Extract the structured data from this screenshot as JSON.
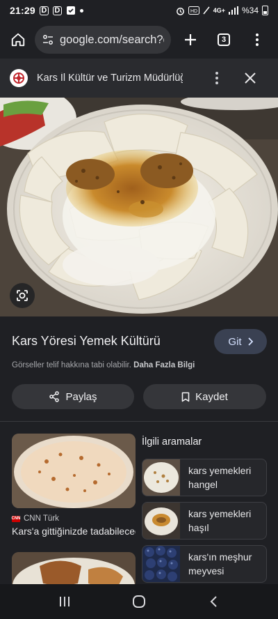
{
  "status_bar": {
    "time": "21:29",
    "left_icons": [
      "D",
      "D"
    ],
    "network": "4G+",
    "battery": "%34"
  },
  "browser": {
    "url": "google.com/search?q",
    "tab_count": "3",
    "icons": [
      "home-icon",
      "tune-icon",
      "plus-icon",
      "tabs-icon",
      "more-vert-icon"
    ]
  },
  "source": {
    "site_name": "Kars İl Kültür ve Turizm Müdürlüğü",
    "icons": [
      "site-favicon",
      "more-vert-icon",
      "close-icon"
    ]
  },
  "image": {
    "title": "Kars Yöresi Yemek Kültürü",
    "visit_label": "Git",
    "copyright_text": "Görseller telif hakkına tabi olabilir.",
    "learn_more_label": "Daha Fazla Bilgi",
    "share_label": "Paylaş",
    "save_label": "Kaydet"
  },
  "results": {
    "first": {
      "source": "CNN Türk",
      "caption": "Kars'a gittiğinizde tadabileceğiniz lezzetler"
    }
  },
  "related": {
    "heading": "İlgili aramalar",
    "items": [
      {
        "label": "kars yemekleri hangel"
      },
      {
        "label": "kars yemekleri haşıl"
      },
      {
        "label": "kars'ın meşhur meyvesi"
      }
    ]
  },
  "colors": {
    "background": "#1f2024",
    "surface": "#35363a",
    "accent_button": "#3a4152"
  }
}
